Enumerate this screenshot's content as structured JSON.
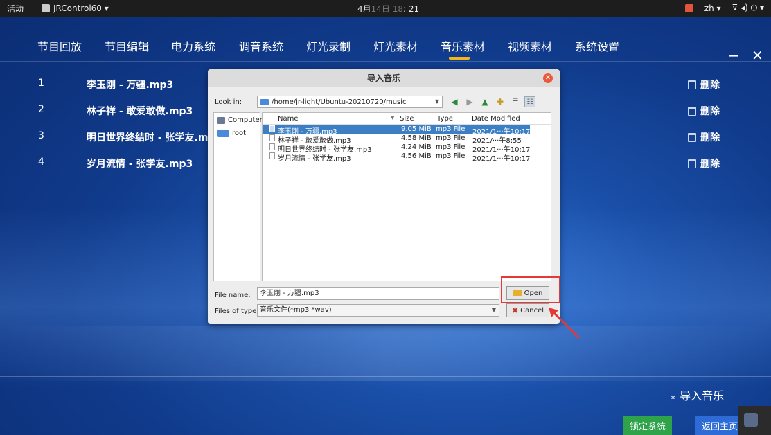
{
  "topbar": {
    "activities": "活动",
    "app_name": "JRControl60 ▾",
    "clock_main": "4月",
    "clock_dim": "14日 18",
    "clock_end": ": 21",
    "lang": "zh ▾",
    "status": "⊽ ◂) ⏻ ▾"
  },
  "nav": {
    "items": [
      {
        "label": "节目回放"
      },
      {
        "label": "节目编辑"
      },
      {
        "label": "电力系统"
      },
      {
        "label": "调音系统"
      },
      {
        "label": "灯光录制"
      },
      {
        "label": "灯光素材"
      },
      {
        "label": "音乐素材"
      },
      {
        "label": "视频素材"
      },
      {
        "label": "系统设置"
      }
    ],
    "active_index": 6,
    "minimize_label": "−",
    "close_label": "✕"
  },
  "list": {
    "delete_label": "删除",
    "rows": [
      {
        "index": "1",
        "name": "李玉刚 - 万疆.mp3"
      },
      {
        "index": "2",
        "name": "林子祥 - 敢爱敢做.mp3"
      },
      {
        "index": "3",
        "name": "明日世界终结时 - 张学友.mp3"
      },
      {
        "index": "4",
        "name": "岁月流情 - 张学友.mp3"
      }
    ]
  },
  "bottom": {
    "import_label": "导入音乐",
    "lock_label": "锁定系统",
    "back_label": "返回主页"
  },
  "dialog": {
    "title": "导入音乐",
    "look_in_label": "Look in:",
    "path": "/home/jr-light/Ubuntu-20210720/music",
    "sidebar": [
      {
        "label": "Computer"
      },
      {
        "label": "root"
      }
    ],
    "columns": {
      "name": "Name",
      "size": "Size",
      "type": "Type",
      "date": "Date Modified"
    },
    "files": [
      {
        "name": "李玉刚 - 万疆.mp3",
        "size": "9.05 MiB",
        "type": "mp3 File",
        "date": "2021/1···午10:17",
        "selected": true
      },
      {
        "name": "林子祥 - 敢爱敢做.mp3",
        "size": "4.58 MiB",
        "type": "mp3 File",
        "date": "2021/···午8:55",
        "selected": false
      },
      {
        "name": "明日世界终结时 - 张学友.mp3",
        "size": "4.24 MiB",
        "type": "mp3 File",
        "date": "2021/1···午10:17",
        "selected": false
      },
      {
        "name": "岁月流情 - 张学友.mp3",
        "size": "4.56 MiB",
        "type": "mp3 File",
        "date": "2021/1···午10:17",
        "selected": false
      }
    ],
    "file_name_label": "File name:",
    "file_name_value": "李玉刚 - 万疆.mp3",
    "files_of_type_label": "Files of type:",
    "files_of_type_value": "音乐文件(*mp3 *wav)",
    "open_label": "Open",
    "cancel_label": "Cancel"
  },
  "colors": {
    "accent_underline": "#f3b61a",
    "lock_button": "#2ea34a",
    "back_button": "#2d6cd6",
    "annotation": "#e53935"
  }
}
